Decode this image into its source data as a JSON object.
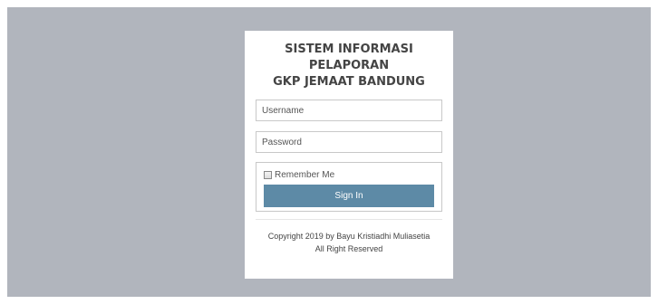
{
  "login": {
    "title_lines": [
      "SISTEM INFORMASI",
      "PELAPORAN",
      "GKP JEMAAT BANDUNG"
    ],
    "username_placeholder": "Username",
    "password_placeholder": "Password",
    "remember_label": "Remember Me",
    "remember_checked": false,
    "signin_label": "Sign In",
    "footer_lines": [
      "Copyright 2019 by Bayu Kristiadhi Muliasetia",
      "All Right Reserved"
    ]
  },
  "colors": {
    "backdrop": "#b1b5bd",
    "card": "#ffffff",
    "button": "#5d8aa6",
    "button_text": "#ffffff",
    "border": "#c8c8c8"
  }
}
